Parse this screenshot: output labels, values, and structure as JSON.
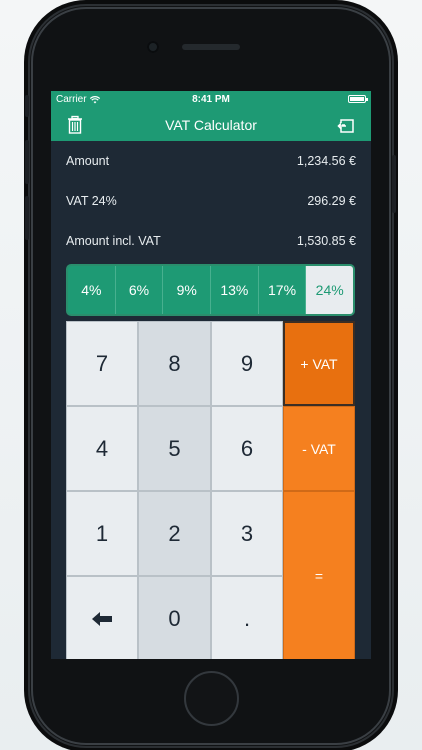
{
  "status": {
    "carrier": "Carrier",
    "time": "8:41 PM"
  },
  "nav": {
    "title": "VAT Calculator"
  },
  "results": [
    {
      "label": "Amount",
      "value": "1,234.56 €"
    },
    {
      "label": "VAT 24%",
      "value": "296.29 €"
    },
    {
      "label": "Amount incl. VAT",
      "value": "1,530.85 €"
    }
  ],
  "rates": [
    "4%",
    "6%",
    "9%",
    "13%",
    "17%",
    "24%"
  ],
  "selected_rate": "24%",
  "keypad": {
    "digits": [
      "7",
      "8",
      "9",
      "4",
      "5",
      "6",
      "1",
      "2",
      "3",
      "0",
      "."
    ],
    "plus_vat": "+ VAT",
    "minus_vat": "- VAT",
    "equals": "="
  },
  "colors": {
    "brand_green": "#1e9a74",
    "operator_orange": "#f5801f",
    "background_dark": "#1e2935"
  },
  "icons": [
    "trash-icon",
    "export-icon",
    "wifi-icon",
    "battery-icon",
    "backspace-icon"
  ]
}
